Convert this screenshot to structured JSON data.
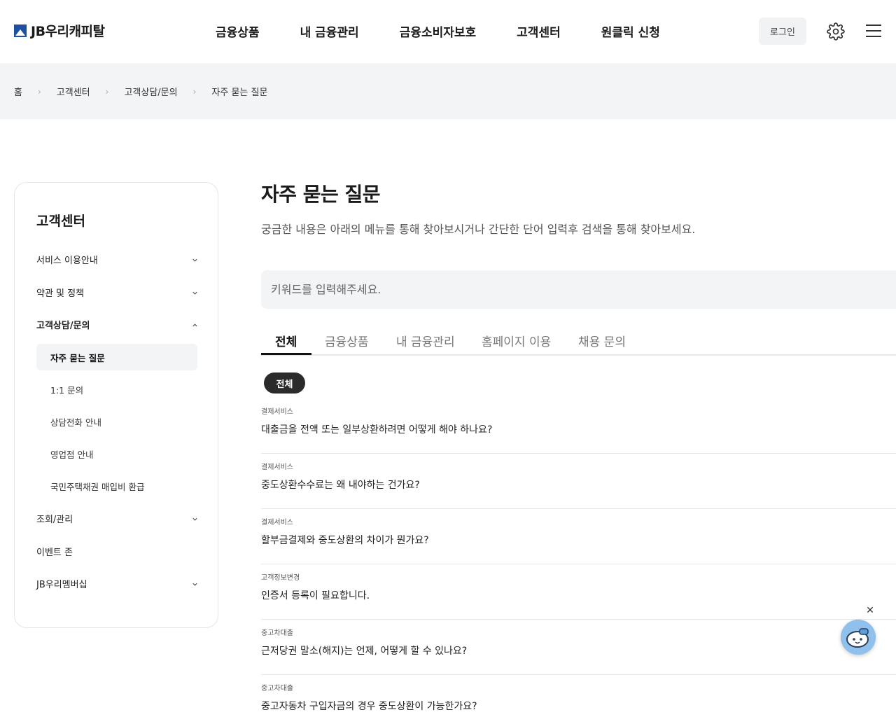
{
  "header": {
    "logo_text": "JB우리캐피탈",
    "gnb": [
      "금융상품",
      "내 금융관리",
      "금융소비자보호",
      "고객센터",
      "원클릭 신청"
    ],
    "login_label": "로그인"
  },
  "breadcrumb": [
    "홈",
    "고객센터",
    "고객상담/문의",
    "자주 묻는 질문"
  ],
  "sidebar": {
    "title": "고객센터",
    "items": [
      {
        "label": "서비스 이용안내",
        "expanded": false
      },
      {
        "label": "약관 및 정책",
        "expanded": false
      },
      {
        "label": "고객상담/문의",
        "expanded": true
      },
      {
        "label": "조회/관리",
        "expanded": false
      },
      {
        "label": "이벤트 존"
      },
      {
        "label": "JB우리멤버십",
        "expanded": false
      }
    ],
    "sub_items": [
      "자주 묻는 질문",
      "1:1 문의",
      "상담전화 안내",
      "영업점 안내",
      "국민주택채권 매입비 환급"
    ]
  },
  "main": {
    "title": "자주 묻는 질문",
    "description": "궁금한 내용은 아래의 메뉴를 통해 찾아보시거나 간단한 단어 입력후 검색을 통해 찾아보세요.",
    "search_placeholder": "키워드를 입력해주세요.",
    "tabs": [
      "전체",
      "금융상품",
      "내 금융관리",
      "홈페이지 이용",
      "채용 문의"
    ],
    "active_tab": "전체",
    "chip": "전체",
    "faqs": [
      {
        "category": "결제서비스",
        "question": "대출금을 전액 또는 일부상환하려면 어떻게 해야 하나요?"
      },
      {
        "category": "결제서비스",
        "question": "중도상환수수료는 왜 내야하는 건가요?"
      },
      {
        "category": "결제서비스",
        "question": "할부금결제와 중도상환의 차이가 뭔가요?"
      },
      {
        "category": "고객정보변경",
        "question": "인증서 등록이 필요합니다."
      },
      {
        "category": "중고차대출",
        "question": "근저당권 말소(해지)는 언제, 어떻게 할 수 있나요?"
      },
      {
        "category": "중고차대출",
        "question": "중고자동차 구입자금의 경우 중도상환이 가능한가요?"
      }
    ]
  },
  "chatbot": {
    "close_symbol": "✕"
  }
}
